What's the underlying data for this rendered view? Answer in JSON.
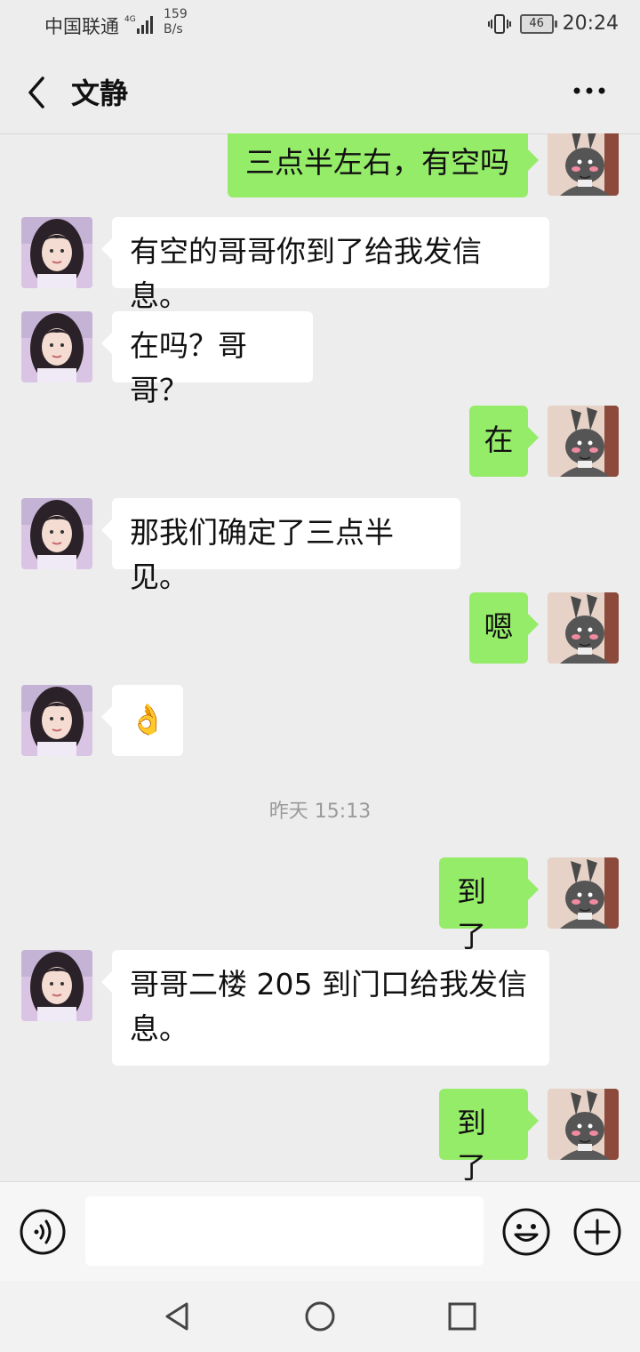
{
  "status_bar": {
    "carrier": "中国联通",
    "net_speed_value": "159",
    "net_speed_unit": "B/s",
    "battery": "46",
    "time": "20:24"
  },
  "header": {
    "title": "文静"
  },
  "messages": [
    {
      "sender": "me",
      "text": "三点半左右，有空吗"
    },
    {
      "sender": "contact",
      "text": "有空的哥哥你到了给我发信息。"
    },
    {
      "sender": "contact",
      "text": "在吗？哥哥？"
    },
    {
      "sender": "me",
      "text": "在"
    },
    {
      "sender": "contact",
      "text": "那我们确定了三点半见。"
    },
    {
      "sender": "me",
      "text": "嗯"
    },
    {
      "sender": "contact",
      "text": "👌"
    },
    {
      "sender": "me",
      "text": "到了"
    },
    {
      "sender": "contact",
      "text": "哥哥二楼 205 到门口给我发信息。"
    },
    {
      "sender": "me",
      "text": "到了"
    }
  ],
  "timestamp": "昨天 15:13",
  "colors": {
    "outgoing_bubble": "#95ec69",
    "incoming_bubble": "#ffffff",
    "background": "#ededed"
  }
}
